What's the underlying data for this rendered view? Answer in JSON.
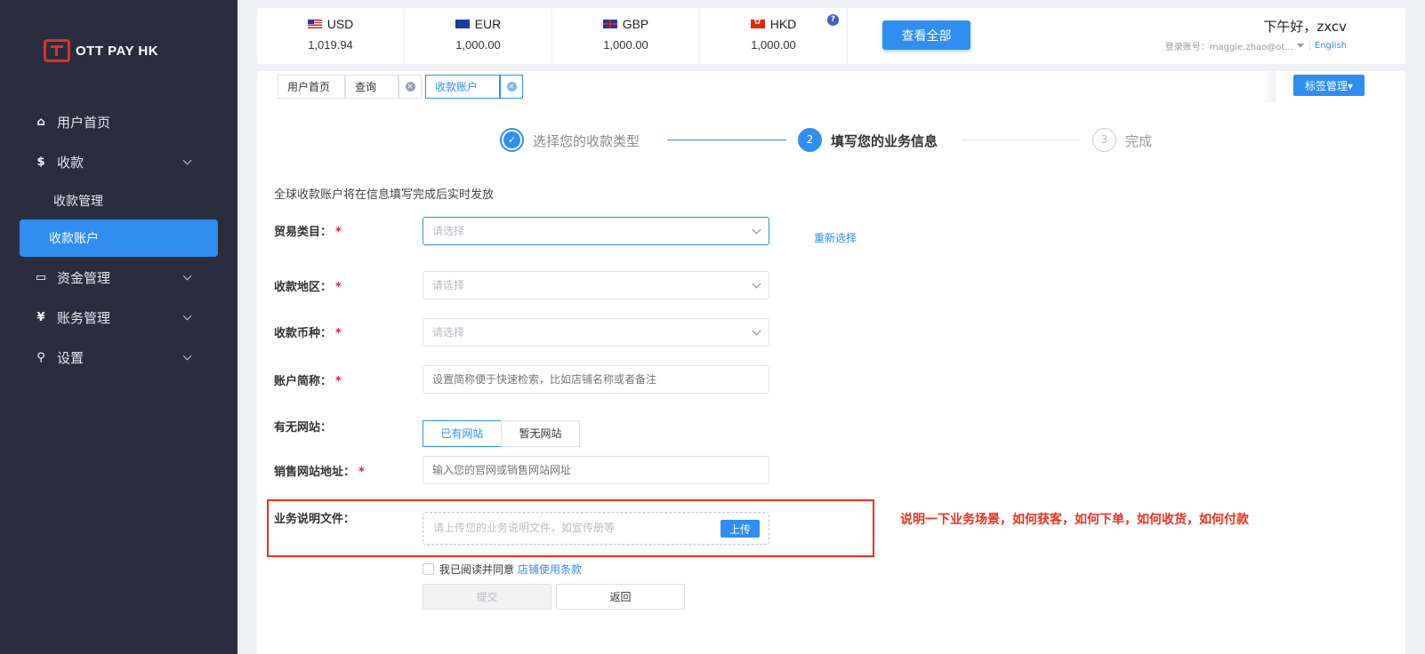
{
  "brand": {
    "logo_text": "OTT PAY HK"
  },
  "sidebar": {
    "items": [
      {
        "label": "用户首页",
        "icon": "home-icon",
        "glyph": "⌂"
      },
      {
        "label": "收款",
        "icon": "dollar-icon",
        "glyph": "$"
      },
      {
        "label": "资金管理",
        "icon": "card-icon",
        "glyph": "▭"
      },
      {
        "label": "账务管理",
        "icon": "yen-icon",
        "glyph": "¥"
      },
      {
        "label": "设置",
        "icon": "search-icon",
        "glyph": "⚲"
      }
    ],
    "sub_items": [
      {
        "label": "收款管理"
      },
      {
        "label": "收款账户",
        "active": true
      }
    ]
  },
  "currencies": [
    {
      "code": "USD",
      "amount": "1,019.94"
    },
    {
      "code": "EUR",
      "amount": "1,000.00"
    },
    {
      "code": "GBP",
      "amount": "1,000.00"
    },
    {
      "code": "HKD",
      "amount": "1,000.00"
    }
  ],
  "header": {
    "help_badge": "?",
    "view_all": "查看全部",
    "greeting": "下午好，zxcv",
    "account_label": "登录账号：maggie.zhao@ot...",
    "language": "English"
  },
  "tabs": [
    {
      "label": "用户首页"
    },
    {
      "label": "查询"
    },
    {
      "label": "收款账户"
    }
  ],
  "tag_management": "标签管理▾",
  "steps": [
    {
      "label": "选择您的收款类型",
      "state": "done",
      "mark": "✓"
    },
    {
      "label": "填写您的业务信息",
      "state": "current",
      "mark": "2"
    },
    {
      "label": "完成",
      "state": "todo",
      "mark": "3"
    }
  ],
  "form": {
    "intro": "全球收款账户将在信息填写完成后实时发放",
    "required_mark": "*",
    "trade_category": {
      "label": "贸易类目：",
      "placeholder": "请选择"
    },
    "reselect": "重新选择",
    "region": {
      "label": "收款地区：",
      "placeholder": "请选择"
    },
    "currency": {
      "label": "收款币种：",
      "placeholder": "请选择"
    },
    "account_name": {
      "label": "账户简称：",
      "placeholder": "设置简称便于快速检索，比如店铺名称或者备注"
    },
    "website": {
      "label": "有无网站：",
      "option_yes": "已有网站",
      "option_no": "暂无网站"
    },
    "website_url": {
      "label": "销售网站地址：",
      "placeholder": "输入您的官网或销售网站网址"
    },
    "business_doc": {
      "label": "业务说明文件：",
      "placeholder": "请上传您的业务说明文件，如宣传册等",
      "upload": "上传"
    },
    "annotation": "说明一下业务场景，如何获客，如何下单，如何收货，如何付款",
    "agree_text": "我已阅读并同意",
    "terms_link": "店铺使用条款",
    "submit": "提交",
    "back": "返回"
  },
  "colors": {
    "accent": "#2f8ef0",
    "sidebar_bg": "#2b2d3e",
    "annotation": "#e8321f"
  }
}
